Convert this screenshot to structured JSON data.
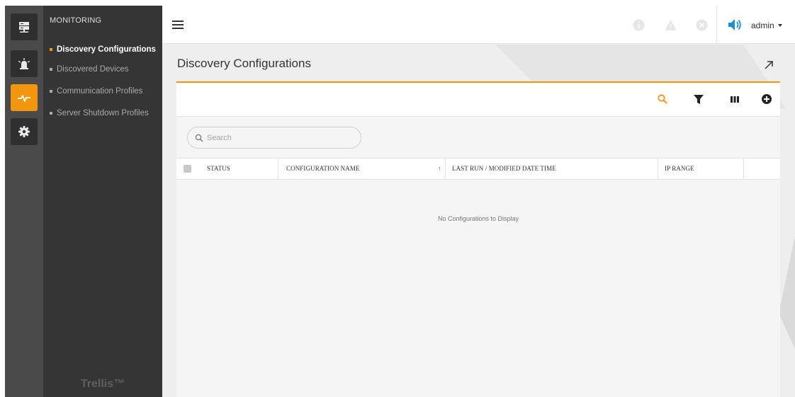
{
  "rail": {
    "items": [
      {
        "icon": "server-icon",
        "active": false
      },
      {
        "icon": "alarm-icon",
        "active": false
      },
      {
        "icon": "pulse-icon",
        "active": true
      },
      {
        "icon": "gear-icon",
        "active": false
      }
    ]
  },
  "nav": {
    "section_title": "MONITORING",
    "items": [
      {
        "label": "Discovery Configurations",
        "active": true
      },
      {
        "label": "Discovered Devices",
        "active": false
      },
      {
        "label": "Communication Profiles",
        "active": false
      },
      {
        "label": "Server Shutdown Profiles",
        "active": false
      }
    ],
    "brand": "Trellis™"
  },
  "header": {
    "status_icons": [
      "info-icon",
      "warning-icon",
      "error-icon"
    ],
    "speaker_icon": "speaker-icon",
    "user": "admin"
  },
  "page": {
    "title": "Discovery Configurations"
  },
  "toolbar": {
    "icons": [
      "search-icon",
      "filter-icon",
      "columns-icon",
      "add-icon"
    ]
  },
  "search": {
    "placeholder": "Search",
    "value": ""
  },
  "table": {
    "columns": [
      "STATUS",
      "CONFIGURATION NAME",
      "LAST RUN / MODIFIED DATE TIME",
      "IP RANGE"
    ],
    "sort_indicator": "↑",
    "rows": [],
    "empty_message": "No Configurations to Display"
  },
  "colors": {
    "accent": "#f2960d",
    "rail_bg": "#4a4a4a",
    "nav_bg": "#353535",
    "speaker": "#1a8fd6"
  }
}
